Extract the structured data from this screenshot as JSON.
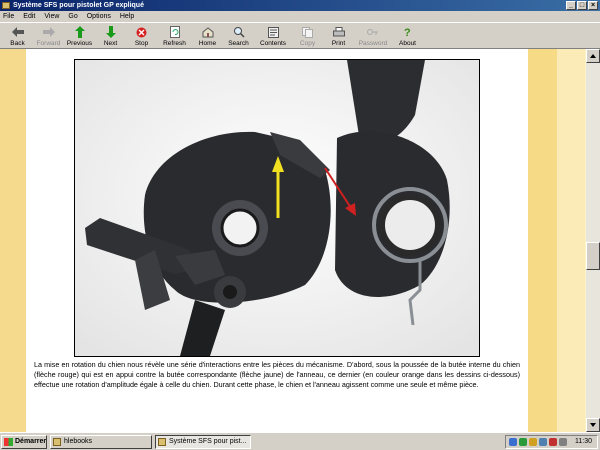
{
  "window": {
    "title": "Système SFS pour pistolet GP expliqué"
  },
  "menu": [
    "File",
    "Edit",
    "View",
    "Go",
    "Options",
    "Help"
  ],
  "toolbar": {
    "back": "Back",
    "forward": "Forward",
    "previous": "Previous",
    "next": "Next",
    "stop": "Stop",
    "refresh": "Refresh",
    "home": "Home",
    "search": "Search",
    "contents": "Contents",
    "copy": "Copy",
    "print": "Print",
    "password": "Password",
    "about": "About"
  },
  "colors": {
    "arrow_yellow": "#f0e020",
    "arrow_red": "#d02020",
    "accent_stripe": "#f5d98d"
  },
  "body_text": "La mise en rotation du chien nous révèle une série d'interactions entre les pièces du mécanisme. D'abord, sous la poussée de la butée interne du chien (flèche rouge) qui est en appui contre la butée correspondante (flèche jaune) de l'anneau, ce dernier (en couleur orange dans les dessins ci-dessous) effectue une rotation d'amplitude égale à celle du chien. Durant cette phase, le chien et l'anneau agissent comme une seule et même pièce.",
  "taskbar": {
    "start": "Démarrer",
    "tasks": [
      "hlebooks",
      "Système SFS pour pist..."
    ],
    "clock": "11:30"
  }
}
